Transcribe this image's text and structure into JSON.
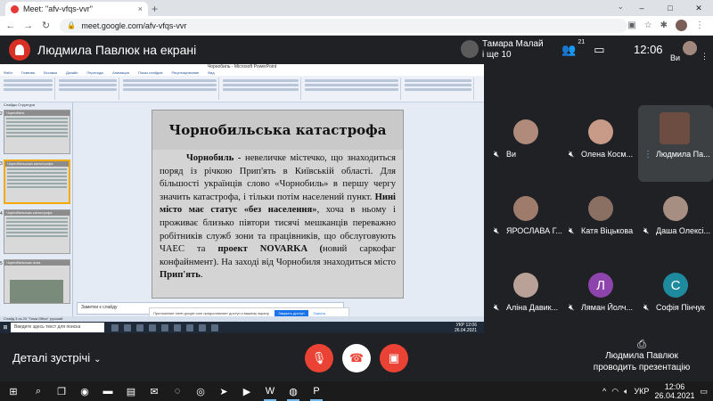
{
  "browser": {
    "tab_title": "Meet: \"afv-vfqs-vvr\"",
    "tab_close": "×",
    "new_tab": "+",
    "url": "meet.google.com/afv-vfqs-vvr",
    "window_controls": [
      "–",
      "□",
      "✕"
    ]
  },
  "meet_header": {
    "presenting_title": "Людмила Павлюк на екрані",
    "speaker_line1": "Тамара Малай",
    "speaker_line2": "і ще 10",
    "participant_count": "21",
    "time": "12:06",
    "self_label": "Ви"
  },
  "powerpoint": {
    "window_title": "Чорнобиль - Microsoft PowerPoint",
    "ribbon_tabs": [
      "Файл",
      "Главная",
      "Вставка",
      "Дизайн",
      "Переходы",
      "Анимация",
      "Показ слайдов",
      "Рецензирование",
      "Вид"
    ],
    "panel_tabs": "Слайды   Структура",
    "thumbnails": [
      {
        "num": "2",
        "title": "Чорнобиль",
        "selected": false
      },
      {
        "num": "3",
        "title": "Чорнобильська катастрофа",
        "selected": true
      },
      {
        "num": "4",
        "title": "Чорнобильська катастрофа",
        "selected": false
      },
      {
        "num": "5",
        "title": "Чорнобильська зона",
        "selected": false
      }
    ],
    "slide": {
      "title": "Чорнобильська катастрофа",
      "p1_bold": "Чорнобиль -",
      "p1": " невеличке містечко, що знаходиться поряд із річкою Прип'ять в Київській області. Для більшості українців слово «Чорнобиль» в першу чергу значить катастрофа, і тільки потім населений пункт. ",
      "p2_bold": "Нині місто має статус «без населення»",
      "p3": ", хоча в ньому і проживає близько півтори тисячі мешканців переважно робітників служб зони та працівників, що обслуговують ЧАЕС та ",
      "p4_bold": "проект NOVARKA (",
      "p5": "новий саркофаг конфайнмент",
      "p6": ").  На заході від Чорнобиля знаходиться місто ",
      "p7_bold": "Прип'ять",
      "p8": "."
    },
    "notes_placeholder": "Заметки к слайду",
    "share_notice": "Приложение meet.google.com предоставляет доступ к вашему экрану.",
    "share_stop": "Закрыть доступ",
    "share_hide": "Скрыть",
    "status_bar": "Слайд 3 из 20    \"Тема Office\"    русский",
    "inner_search": "Введите здесь текст для поиска",
    "inner_time": "12:06",
    "inner_date": "26.04.2021",
    "inner_lang": "УКР"
  },
  "participants": [
    {
      "name": "Ви",
      "initial": "",
      "color": "#b08a7a",
      "speaking": false
    },
    {
      "name": "Олена Косм...",
      "initial": "",
      "color": "#c79b88",
      "speaking": false
    },
    {
      "name": "Людмила Па...",
      "initial": "",
      "color": "#6d4c41",
      "speaking": true
    },
    {
      "name": "ЯРОСЛАВА Г...",
      "initial": "",
      "color": "#9e7b6a",
      "speaking": false
    },
    {
      "name": "Катя Віцькова",
      "initial": "",
      "color": "#8a6f63",
      "speaking": false
    },
    {
      "name": "Даша Олексі...",
      "initial": "",
      "color": "#a78e82",
      "speaking": false
    },
    {
      "name": "Аліна Давик...",
      "initial": "",
      "color": "#b9a197",
      "speaking": false
    },
    {
      "name": "Ляман Йолч...",
      "initial": "Л",
      "color": "#8e44ad",
      "speaking": false
    },
    {
      "name": "Софія Пінчук",
      "initial": "С",
      "color": "#1e8a9e",
      "speaking": false
    }
  ],
  "bottom": {
    "details": "Деталі зустрічі",
    "present_line1": "Людмила Павлюк",
    "present_line2": "проводить презентацію"
  },
  "taskbar": {
    "time": "12:06",
    "date": "26.04.2021",
    "lang": "УКР"
  }
}
